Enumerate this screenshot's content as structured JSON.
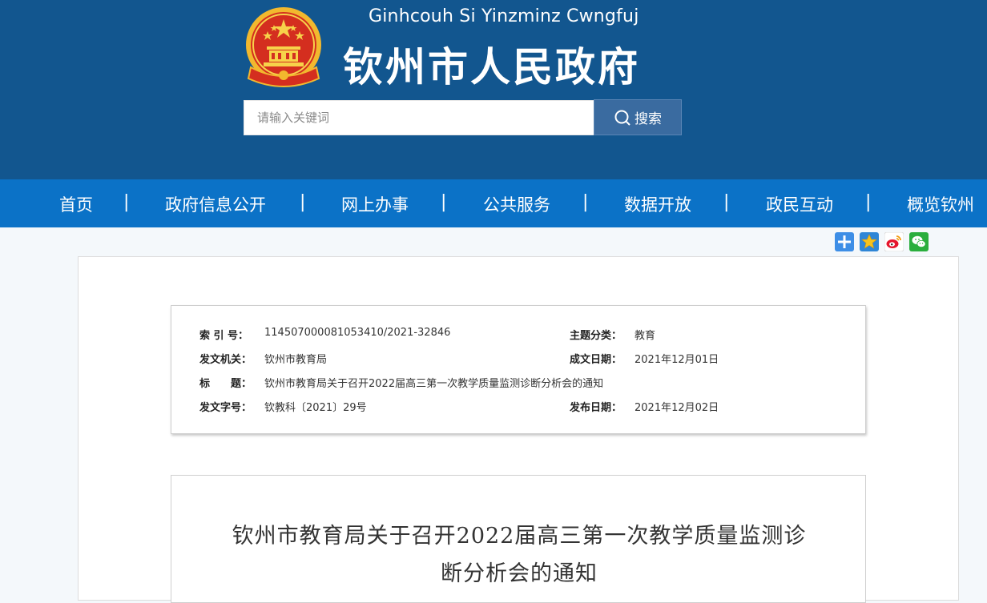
{
  "header": {
    "pinyin": "Ginhcouh Si Yinzminz Cwngfuj",
    "title": "钦州市人民政府",
    "search_placeholder": "请输入关键词",
    "search_button": "搜索",
    "emblem_icon": "national-emblem-icon",
    "colors": {
      "header_bg": "#12568f",
      "nav_bg": "#0b72c7",
      "search_btn_bg": "#3a6ba0"
    }
  },
  "nav": {
    "items": [
      {
        "label": "首页"
      },
      {
        "label": "政府信息公开"
      },
      {
        "label": "网上办事"
      },
      {
        "label": "公共服务"
      },
      {
        "label": "数据开放"
      },
      {
        "label": "政民互动"
      },
      {
        "label": "概览钦州"
      }
    ],
    "separator": "|"
  },
  "share": {
    "icons": [
      "plus-share-icon",
      "star-favorite-icon",
      "weibo-icon",
      "wechat-icon"
    ]
  },
  "meta": {
    "index_label": "索 引 号：",
    "index_value": "114507000081053410/2021-32846",
    "subject_label": "主题分类：",
    "subject_value": "教育",
    "issuer_label": "发文机关：",
    "issuer_value": "钦州市教育局",
    "date_made_label": "成文日期：",
    "date_made_value": "2021年12月01日",
    "title_label": "标　　题：",
    "title_value": "钦州市教育局关于召开2022届高三第一次教学质量监测诊断分析会的通知",
    "doc_no_label": "发文字号：",
    "doc_no_value": "钦教科〔2021〕29号",
    "pub_date_label": "发布日期：",
    "pub_date_value": "2021年12月02日"
  },
  "article": {
    "title_line1": "钦州市教育局关于召开2022届高三第一次教学质量监测诊",
    "title_line2": "断分析会的通知"
  }
}
